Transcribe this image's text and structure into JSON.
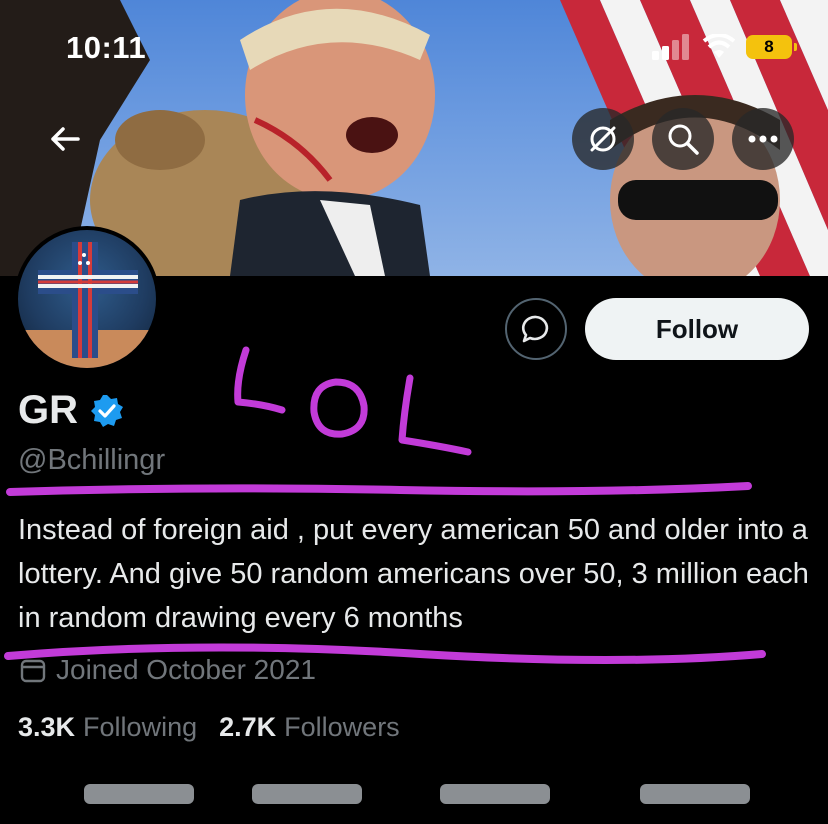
{
  "status_bar": {
    "time": "10:11",
    "battery": "8"
  },
  "header": {
    "back_icon": "arrow-left-icon",
    "actions": [
      "grok-icon",
      "search-icon",
      "more-icon"
    ]
  },
  "profile": {
    "name": "GR",
    "handle": "@Bchillingr",
    "verified": true,
    "bio": "Instead of foreign aid , put every american 50 and older into a lottery. And give 50 random americans over 50, 3 million each in random drawing every 6 months",
    "joined": "Joined October 2021",
    "following_count": "3.3K",
    "following_label": "Following",
    "followers_count": "2.7K",
    "followers_label": "Followers"
  },
  "buttons": {
    "follow_label": "Follow"
  },
  "annotation": {
    "text": "LOL",
    "color": "#c23bd8"
  },
  "colors": {
    "background": "#000000",
    "secondary_text": "#71767b",
    "verified": "#1d9bf0"
  }
}
